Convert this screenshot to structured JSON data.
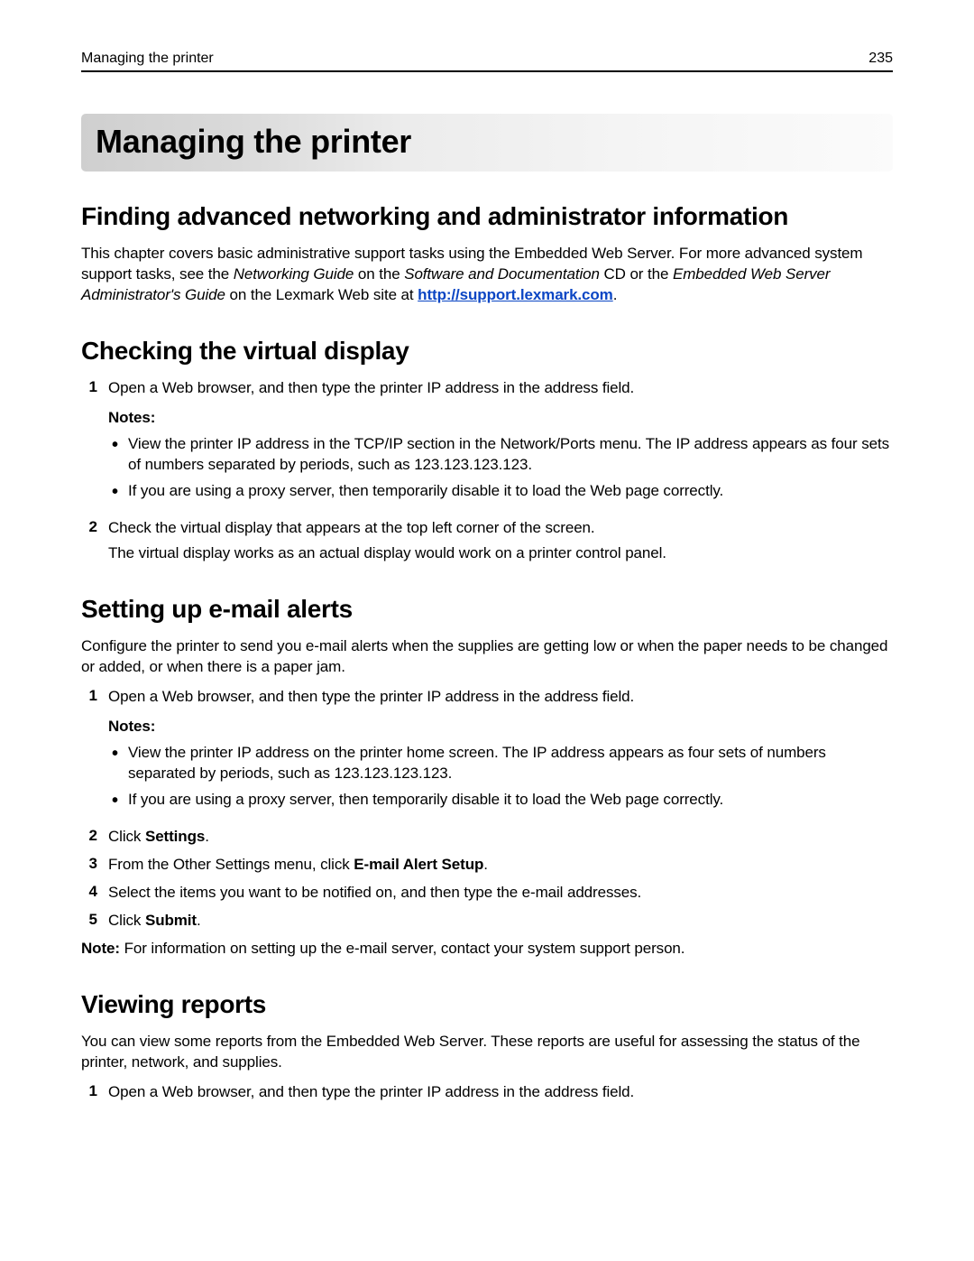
{
  "header": {
    "running_title": "Managing the printer",
    "page_number": "235"
  },
  "title": "Managing the printer",
  "s1": {
    "heading": "Finding advanced networking and administrator information",
    "p_a": "This chapter covers basic administrative support tasks using the Embedded Web Server. For more advanced system support tasks, see the ",
    "em1": "Networking Guide",
    "p_b": " on the ",
    "em2": "Software and Documentation",
    "p_c": " CD or the ",
    "em3": "Embedded Web Server Administrator's Guide",
    "p_d": " on the Lexmark Web site at ",
    "link": "http://support.lexmark.com",
    "p_e": "."
  },
  "s2": {
    "heading": "Checking the virtual display",
    "step1": "Open a Web browser, and then type the printer IP address in the address field.",
    "notes_label": "Notes:",
    "bullet1": "View the printer IP address in the TCP/IP section in the Network/Ports menu. The IP address appears as four sets of numbers separated by periods, such as 123.123.123.123.",
    "bullet2": "If you are using a proxy server, then temporarily disable it to load the Web page correctly.",
    "step2a": "Check the virtual display that appears at the top left corner of the screen.",
    "step2b": "The virtual display works as an actual display would work on a printer control panel."
  },
  "s3": {
    "heading": "Setting up e‑mail alerts",
    "intro": "Configure the printer to send you e‑mail alerts when the supplies are getting low or when the paper needs to be changed or added, or when there is a paper jam.",
    "step1": "Open a Web browser, and then type the printer IP address in the address field.",
    "notes_label": "Notes:",
    "bullet1": "View the printer IP address on the printer home screen. The IP address appears as four sets of numbers separated by periods, such as 123.123.123.123.",
    "bullet2": "If you are using a proxy server, then temporarily disable it to load the Web page correctly.",
    "step2_a": "Click ",
    "step2_b": "Settings",
    "step2_c": ".",
    "step3_a": "From the Other Settings menu, click ",
    "step3_b": "E‑mail Alert Setup",
    "step3_c": ".",
    "step4": "Select the items you want to be notified on, and then type the e‑mail addresses.",
    "step5_a": "Click ",
    "step5_b": "Submit",
    "step5_c": ".",
    "note_label": "Note:",
    "note_body": " For information on setting up the e‑mail server, contact your system support person."
  },
  "s4": {
    "heading": "Viewing reports",
    "intro": "You can view some reports from the Embedded Web Server. These reports are useful for assessing the status of the printer, network, and supplies.",
    "step1": "Open a Web browser, and then type the printer IP address in the address field."
  },
  "nums": {
    "n1": "1",
    "n2": "2",
    "n3": "3",
    "n4": "4",
    "n5": "5"
  }
}
